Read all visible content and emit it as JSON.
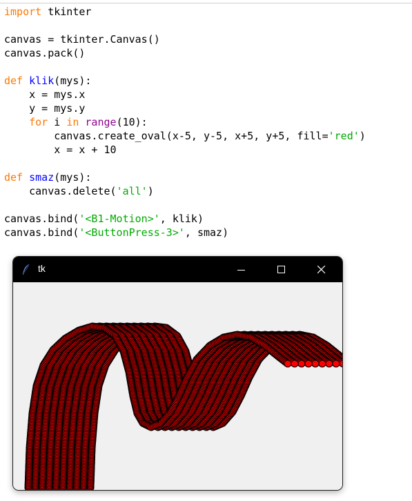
{
  "editor": {
    "lines": [
      [
        {
          "t": "import",
          "c": "kw"
        },
        {
          "t": " tkinter",
          "c": ""
        }
      ],
      [],
      [
        {
          "t": "canvas = tkinter.Canvas()",
          "c": ""
        }
      ],
      [
        {
          "t": "canvas.pack()",
          "c": ""
        }
      ],
      [],
      [
        {
          "t": "def",
          "c": "kw"
        },
        {
          "t": " ",
          "c": ""
        },
        {
          "t": "klik",
          "c": "fn"
        },
        {
          "t": "(mys):",
          "c": ""
        }
      ],
      [
        {
          "t": "    x = mys.x",
          "c": ""
        }
      ],
      [
        {
          "t": "    y = mys.y",
          "c": ""
        }
      ],
      [
        {
          "t": "    ",
          "c": ""
        },
        {
          "t": "for",
          "c": "kw"
        },
        {
          "t": " i ",
          "c": ""
        },
        {
          "t": "in",
          "c": "kw"
        },
        {
          "t": " ",
          "c": ""
        },
        {
          "t": "range",
          "c": "bi"
        },
        {
          "t": "(10):",
          "c": ""
        }
      ],
      [
        {
          "t": "        canvas.create_oval(x-5, y-5, x+5, y+5, fill=",
          "c": ""
        },
        {
          "t": "'red'",
          "c": "str"
        },
        {
          "t": ")",
          "c": ""
        }
      ],
      [
        {
          "t": "        x = x + 10",
          "c": ""
        }
      ],
      [],
      [
        {
          "t": "def",
          "c": "kw"
        },
        {
          "t": " ",
          "c": ""
        },
        {
          "t": "smaz",
          "c": "fn"
        },
        {
          "t": "(mys):",
          "c": ""
        }
      ],
      [
        {
          "t": "    canvas.delete(",
          "c": ""
        },
        {
          "t": "'all'",
          "c": "str"
        },
        {
          "t": ")",
          "c": ""
        }
      ],
      [],
      [
        {
          "t": "canvas.bind(",
          "c": ""
        },
        {
          "t": "'<B1-Motion>'",
          "c": "str"
        },
        {
          "t": ", klik)",
          "c": ""
        }
      ],
      [
        {
          "t": "canvas.bind(",
          "c": ""
        },
        {
          "t": "'<ButtonPress-3>'",
          "c": "str"
        },
        {
          "t": ", smaz)",
          "c": ""
        }
      ]
    ]
  },
  "window": {
    "title": "tk",
    "icon": "feather-icon",
    "buttons": [
      {
        "name": "minimize-button",
        "icon": "minimize-icon"
      },
      {
        "name": "maximize-button",
        "icon": "maximize-icon"
      },
      {
        "name": "close-button",
        "icon": "close-icon"
      }
    ]
  },
  "canvas": {
    "oval_fill": "#ff0000",
    "oval_outline": "#000000",
    "background": "#f0f0f0"
  }
}
